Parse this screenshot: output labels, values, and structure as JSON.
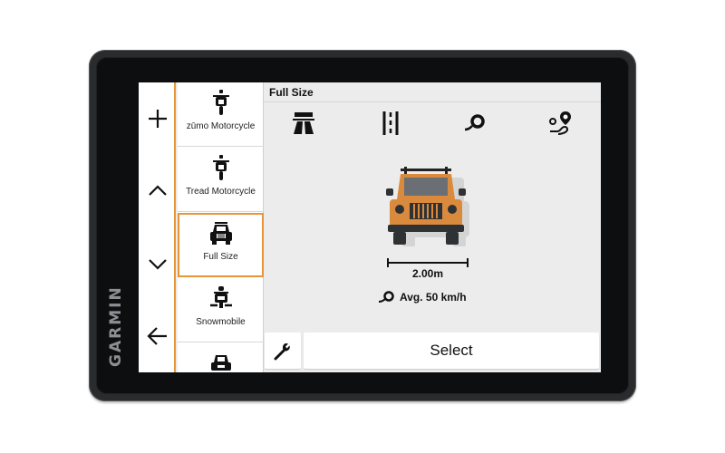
{
  "device": {
    "brand": "GARMIN"
  },
  "nav": {
    "add_icon": "plus-icon",
    "up_icon": "chevron-up-icon",
    "down_icon": "chevron-down-icon",
    "back_icon": "back-arrow-icon"
  },
  "vehicles": [
    {
      "label": "zūmo Motorcycle",
      "icon": "motorcycle-icon"
    },
    {
      "label": "Tread Motorcycle",
      "icon": "motorcycle-icon"
    },
    {
      "label": "Full Size",
      "icon": "suv-icon",
      "selected": true
    },
    {
      "label": "Snowmobile",
      "icon": "snowmobile-icon"
    },
    {
      "label": "",
      "icon": "car-icon"
    }
  ],
  "panel": {
    "title": "Full Size",
    "top_icons": [
      "highway-icon",
      "lane-icon",
      "speed-icon",
      "route-icon"
    ],
    "dimension": "2.00m",
    "avg_speed": "Avg. 50 km/h",
    "select_label": "Select"
  },
  "colors": {
    "accent": "#e8953a",
    "vehicle_body": "#d98a3d",
    "screen_bg": "#ececec"
  }
}
